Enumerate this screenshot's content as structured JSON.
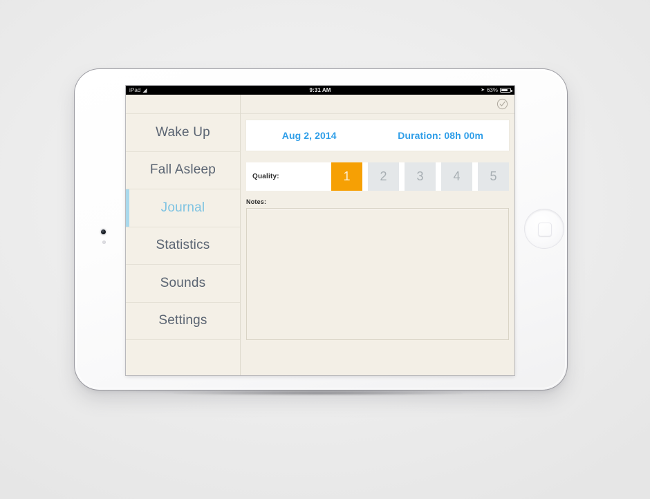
{
  "device": {
    "name": "ipad-mini-white",
    "camera_icon": "front-camera",
    "home_button_icon": "home-button"
  },
  "status_bar": {
    "device_label": "iPad",
    "wifi_icon": "wifi-icon",
    "time": "9:31 AM",
    "location_icon": "location-arrow-icon",
    "battery_percent": "63%",
    "battery_icon": "battery-icon",
    "battery_level": 63
  },
  "sidebar": {
    "items": [
      {
        "label": "Wake Up",
        "selected": false
      },
      {
        "label": "Fall Asleep",
        "selected": false
      },
      {
        "label": "Journal",
        "selected": true
      },
      {
        "label": "Statistics",
        "selected": false
      },
      {
        "label": "Sounds",
        "selected": false
      },
      {
        "label": "Settings",
        "selected": false
      }
    ]
  },
  "toolbar": {
    "done_icon": "check-circle-icon"
  },
  "entry": {
    "date": "Aug 2, 2014",
    "duration": "Duration: 08h 00m",
    "quality_label": "Quality:",
    "quality_options": [
      "1",
      "2",
      "3",
      "4",
      "5"
    ],
    "quality_selected": "1",
    "notes_label": "Notes:",
    "notes_value": "",
    "notes_placeholder": ""
  },
  "colors": {
    "accent_blue": "#2f9ee8",
    "selected_blue": "#7ec3e2",
    "accent_bar_blue": "#a9d9ec",
    "quality_orange": "#f6a004",
    "app_background": "#f3efe6",
    "sidebar_background": "#f4f0e7",
    "segment_inactive": "#e4e7e9"
  }
}
